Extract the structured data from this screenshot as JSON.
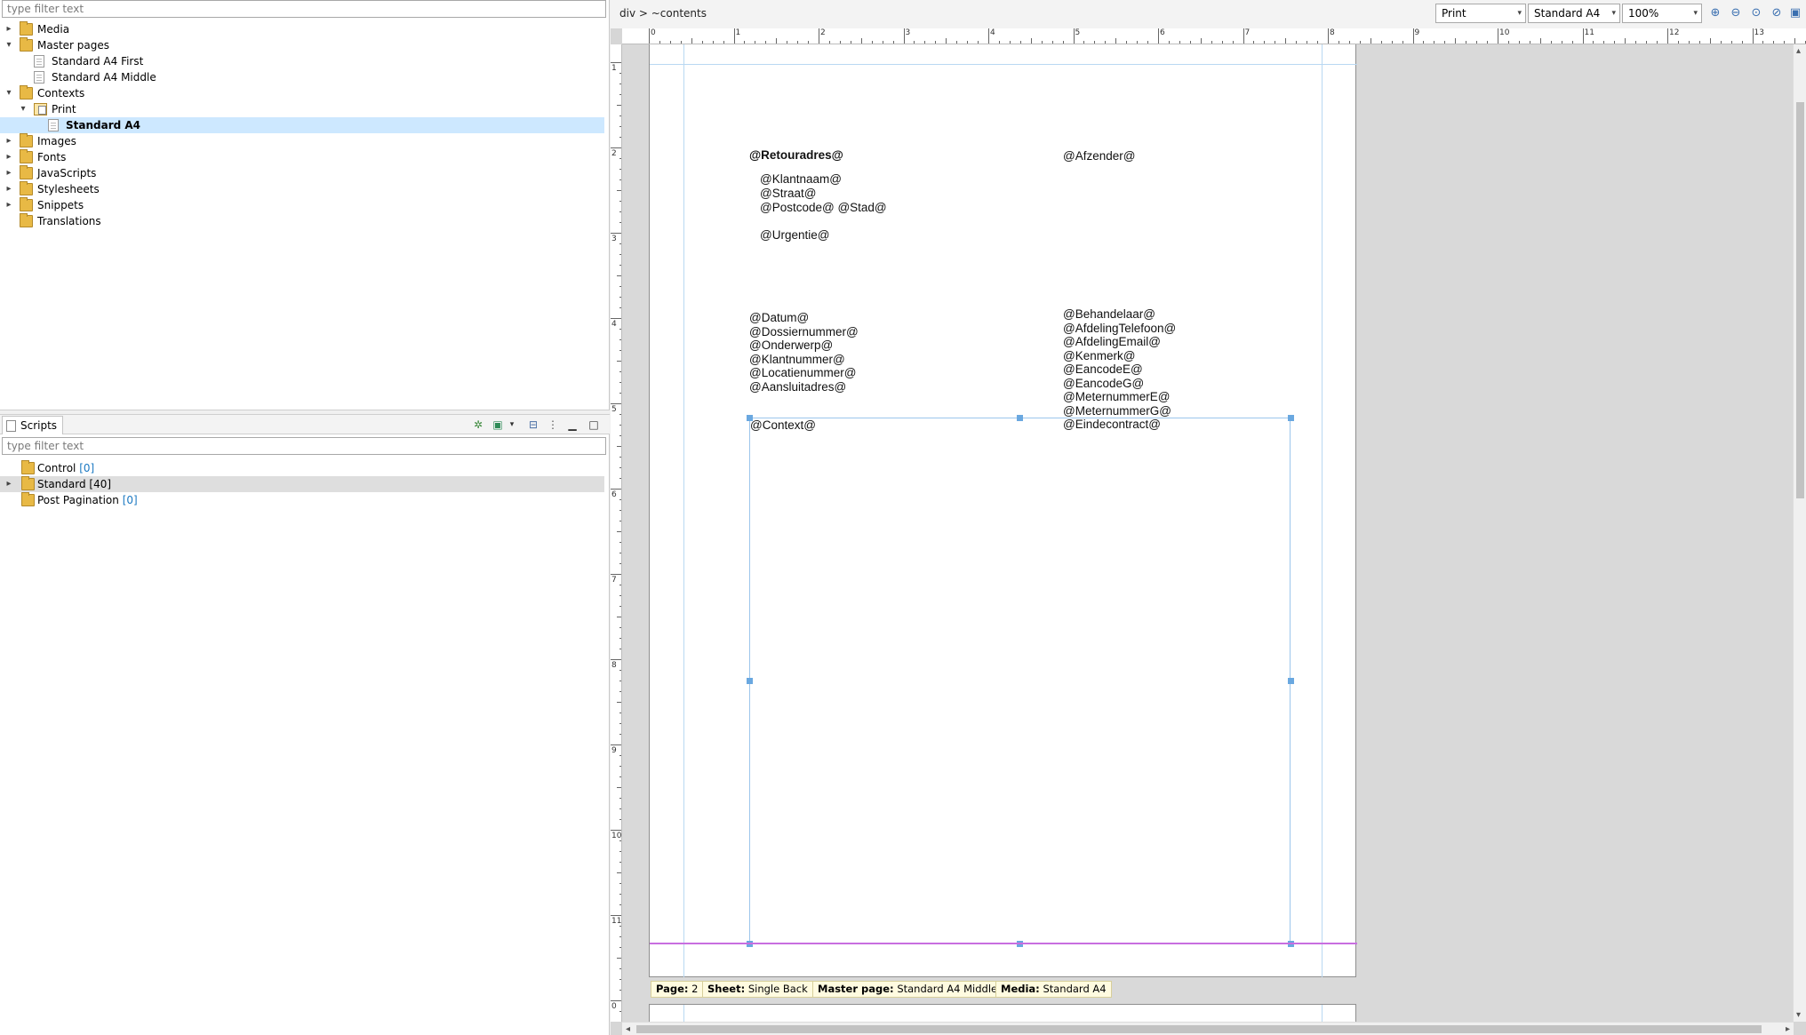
{
  "resources": {
    "filter_placeholder": "type filter text",
    "tree": [
      {
        "label": "Media",
        "type": "folder",
        "depth": 0,
        "expandable": true,
        "expanded": false
      },
      {
        "label": "Master pages",
        "type": "folder",
        "depth": 0,
        "expandable": true,
        "expanded": true
      },
      {
        "label": "Standard A4 First",
        "type": "page",
        "depth": 1
      },
      {
        "label": "Standard A4 Middle",
        "type": "page",
        "depth": 1
      },
      {
        "label": "Contexts",
        "type": "folder",
        "depth": 0,
        "expandable": true,
        "expanded": true
      },
      {
        "label": "Print",
        "type": "context",
        "depth": 1,
        "expandable": true,
        "expanded": true
      },
      {
        "label": "Standard A4",
        "type": "page",
        "depth": 2,
        "selected": true
      },
      {
        "label": "Images",
        "type": "folder",
        "depth": 0,
        "expandable": true,
        "expanded": false
      },
      {
        "label": "Fonts",
        "type": "folder",
        "depth": 0,
        "expandable": true,
        "expanded": false
      },
      {
        "label": "JavaScripts",
        "type": "folder",
        "depth": 0,
        "expandable": true,
        "expanded": false
      },
      {
        "label": "Stylesheets",
        "type": "folder",
        "depth": 0,
        "expandable": true,
        "expanded": false
      },
      {
        "label": "Snippets",
        "type": "folder",
        "depth": 0,
        "expandable": true,
        "expanded": false
      },
      {
        "label": "Translations",
        "type": "folder",
        "depth": 0,
        "expandable": false
      }
    ]
  },
  "scripts": {
    "tab_label": "Scripts",
    "filter_placeholder": "type filter text",
    "items": [
      {
        "label": "Control",
        "count": "[0]",
        "count_colored": true,
        "expandable": false
      },
      {
        "label": "Standard",
        "count": "[40]",
        "count_colored": false,
        "expandable": true,
        "highlighted": true
      },
      {
        "label": "Post Pagination",
        "count": "[0]",
        "count_colored": true,
        "expandable": false
      }
    ]
  },
  "editor": {
    "breadcrumb": "div > ~contents",
    "output_select": "Print",
    "section_select": "Standard A4",
    "zoom_select": "100%",
    "hruler_labels": [
      "0",
      "1",
      "2",
      "3",
      "4",
      "5",
      "6",
      "7",
      "8",
      "9",
      "10",
      "11",
      "12",
      "13"
    ],
    "vruler_labels": [
      "1",
      "2",
      "3",
      "4",
      "5",
      "6",
      "7",
      "8",
      "9",
      "10",
      "11",
      "0"
    ]
  },
  "document": {
    "left_fields": [
      "@Retouradres@",
      "@Klantnaam@",
      "@Straat@",
      "@Postcode@ @Stad@",
      "@Urgentie@"
    ],
    "right_top": "@Afzender@",
    "left_info": [
      "@Datum@",
      "@Dossiernummer@",
      "@Onderwerp@",
      "@Klantnummer@",
      "@Locatienummer@",
      "@Aansluitadres@"
    ],
    "right_info": [
      "@Behandelaar@",
      "@AfdelingTelefoon@",
      "@AfdelingEmail@",
      "@Kenmerk@",
      "@EancodeE@",
      "@EancodeG@",
      "@MeternummerE@",
      "@MeternummerG@",
      "@Eindecontract@"
    ],
    "context_field": "@Context@"
  },
  "status": {
    "page_label": "Page:",
    "page_value": "2",
    "sheet_label": "Sheet:",
    "sheet_value": "Single Back",
    "master_label": "Master page:",
    "master_value": "Standard A4 Middle",
    "media_label": "Media:",
    "media_value": "Standard A4"
  },
  "colors": {
    "selection": "#cde8ff",
    "guide": "#b9d8f2",
    "handle": "#6aa8e0",
    "margin_line": "#c86ee0",
    "count": "#1a78c2"
  }
}
